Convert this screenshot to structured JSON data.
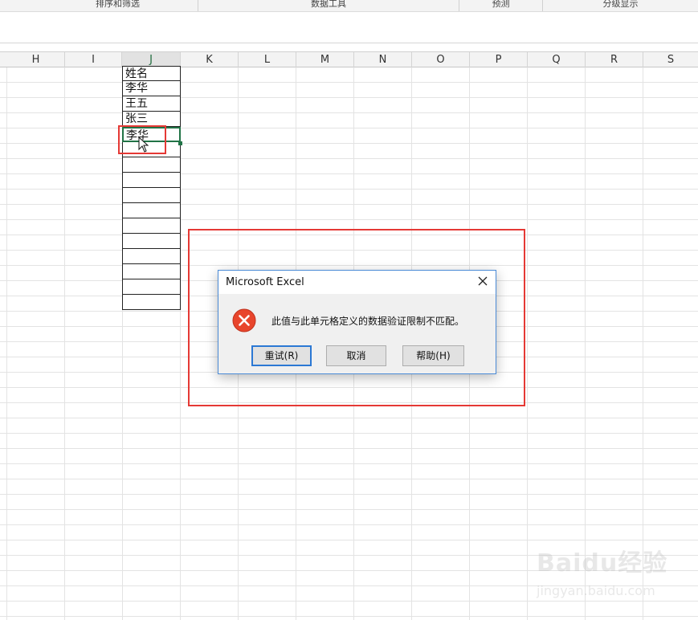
{
  "ribbon": {
    "groups": [
      "排序和筛选",
      "数据工具",
      "预测",
      "分级显示"
    ]
  },
  "columns": [
    "H",
    "I",
    "J",
    "K",
    "L",
    "M",
    "N",
    "O",
    "P",
    "Q",
    "R",
    "S"
  ],
  "active_column": "J",
  "column_j_values": [
    "姓名",
    "李华",
    "王五",
    "张三",
    "李华",
    "",
    "",
    "",
    "",
    "",
    "",
    "",
    "",
    "",
    "",
    ""
  ],
  "dialog": {
    "title": "Microsoft Excel",
    "message": "此值与此单元格定义的数据验证限制不匹配。",
    "icon": "error-x-icon",
    "buttons": {
      "retry": "重试(R)",
      "cancel": "取消",
      "help": "帮助(H)"
    }
  },
  "watermark": {
    "logo": "Baidu经验",
    "url": "jingyan.baidu.com"
  },
  "colors": {
    "accent_green": "#217346",
    "highlight_red": "#e53935",
    "dialog_border": "#4a8ad6",
    "error_red": "#e8452c"
  }
}
